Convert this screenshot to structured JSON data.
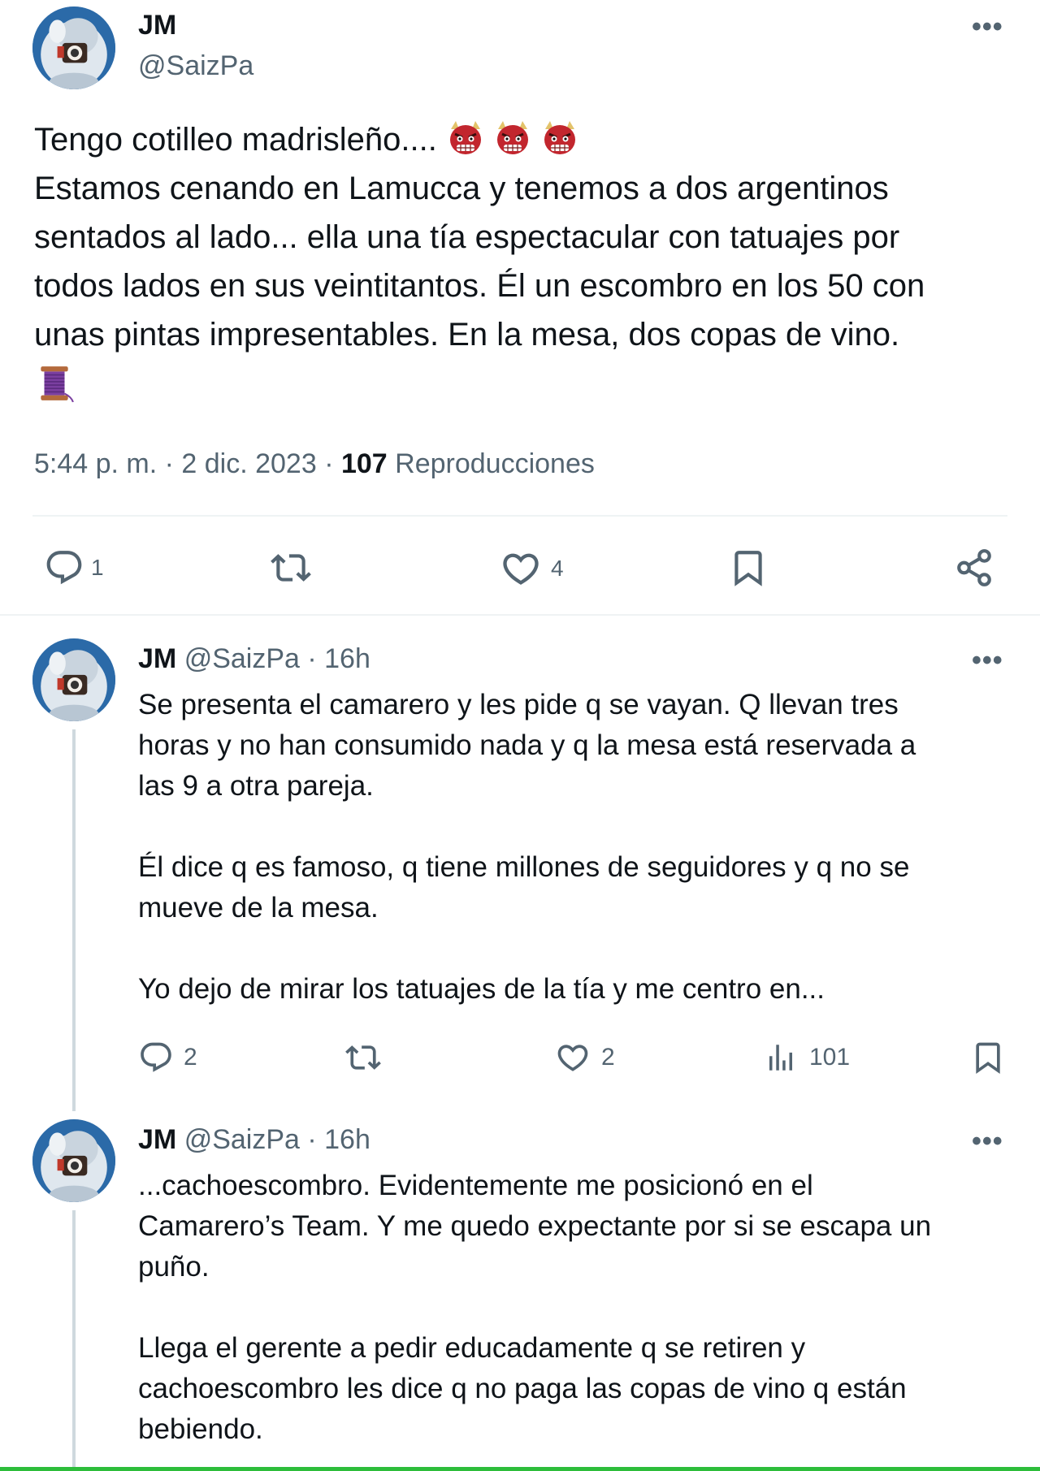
{
  "main_tweet": {
    "display_name": "JM",
    "handle": "@SaizPa",
    "more": "•••",
    "lines": [
      "Tengo cotilleo madrisleño....",
      "Estamos cenando en Lamucca y tenemos a dos argentinos",
      "sentados al lado... ella una tía espectacular con tatuajes por",
      "todos lados en sus veintitantos. Él un escombro en los 50 con",
      "unas pintas impresentables. En la mesa, dos copas de vino."
    ],
    "emojis": [
      "ogre-emoji",
      "ogre-emoji",
      "ogre-emoji",
      "thread-spool-emoji"
    ],
    "timestamp": "5:44 p. m. · 2 dic. 2023 ·",
    "views_count": "107",
    "views_label": "Reproducciones",
    "actions": {
      "replies": "1",
      "retweets": "",
      "likes": "4"
    }
  },
  "replies": [
    {
      "display_name": "JM",
      "handle": "@SaizPa · 16h",
      "more": "•••",
      "paragraphs": [
        [
          "Se presenta el camarero y les pide q se vayan. Q llevan tres",
          "horas y no han consumido nada y q la mesa está reservada a",
          "las 9 a otra pareja."
        ],
        [
          "Él dice q es famoso, q tiene millones de seguidores y q no se",
          "mueve de la mesa."
        ],
        [
          "Yo dejo de mirar los tatuajes de la tía y me centro en..."
        ]
      ],
      "actions": {
        "replies": "2",
        "likes": "2",
        "views": "101"
      }
    },
    {
      "display_name": "JM",
      "handle": "@SaizPa · 16h",
      "more": "•••",
      "paragraphs": [
        [
          "...cachoescombro. Evidentemente me posicionó en el",
          "Camarero’s Team. Y me quedo expectante por si se escapa un",
          "puño."
        ],
        [
          "Llega el gerente a pedir educadamente q se retiren y",
          "cachoescombro les dice q no paga las copas de vino q están",
          "bebiendo."
        ]
      ]
    }
  ],
  "icons": [
    "reply-icon",
    "retweet-icon",
    "like-icon",
    "bookmark-icon",
    "share-icon",
    "views-icon"
  ],
  "colors": {
    "text": "#0f1419",
    "muted": "#536471",
    "divider": "#eff3f4",
    "thread_line": "#cfd9de",
    "bottom_bar": "#2dbd3a"
  }
}
